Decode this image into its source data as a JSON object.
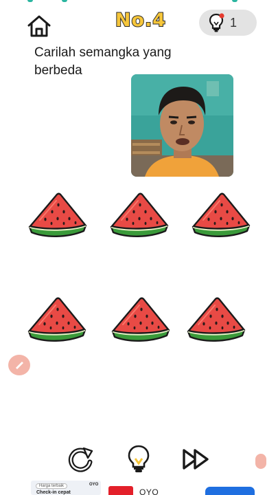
{
  "header": {
    "level_label": "No.4",
    "hint_count": "1",
    "home_icon": "home-icon",
    "hint_icon": "lightbulb-icon"
  },
  "question": {
    "line1": "Carilah semangka yang",
    "line2": "berbeda"
  },
  "puzzle": {
    "items": [
      {
        "name": "watermelon-slice-1"
      },
      {
        "name": "watermelon-slice-2"
      },
      {
        "name": "watermelon-slice-3"
      },
      {
        "name": "watermelon-slice-4"
      },
      {
        "name": "watermelon-slice-5"
      },
      {
        "name": "watermelon-slice-6"
      }
    ],
    "colors": {
      "flesh": "#e84a45",
      "rind": "#3a9a3a",
      "seed": "#2a1a1a",
      "outline": "#1a1a1a"
    }
  },
  "controls": {
    "restart_icon": "restart-icon",
    "hint_icon": "lightbulb-icon",
    "skip_icon": "fast-forward-icon"
  },
  "ad": {
    "badge": "Harga terbaik",
    "card_brand": "OYO",
    "card_text": "Check-in cepat",
    "brand": "OYO"
  },
  "theme": {
    "title_yellow": "#f6c63b",
    "pill_gray": "#e3e3e3",
    "cta_blue": "#1f6fe0"
  }
}
